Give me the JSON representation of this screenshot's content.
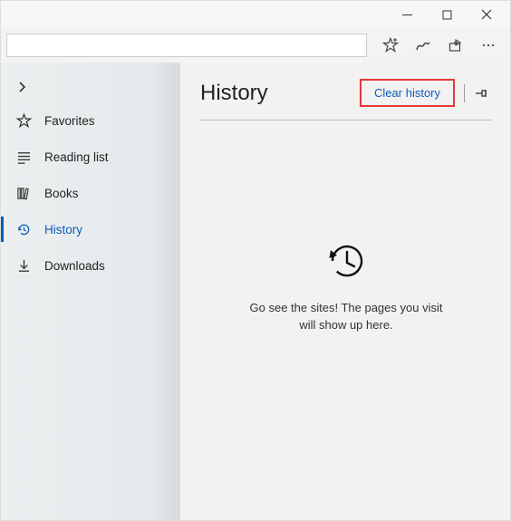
{
  "toolbar": {
    "minimize_icon": "minimize",
    "maximize_icon": "maximize",
    "close_icon": "close",
    "star_icon": "favorite-add",
    "ink_icon": "ink",
    "share_icon": "share",
    "more_icon": "more"
  },
  "sidebar": {
    "items": [
      {
        "label": "Favorites",
        "icon": "star"
      },
      {
        "label": "Reading list",
        "icon": "list"
      },
      {
        "label": "Books",
        "icon": "books"
      },
      {
        "label": "History",
        "icon": "history"
      },
      {
        "label": "Downloads",
        "icon": "download"
      }
    ]
  },
  "main": {
    "title": "History",
    "clear_label": "Clear history",
    "empty": {
      "line1": "Go see the sites! The pages you visit",
      "line2": "will show up here."
    }
  }
}
